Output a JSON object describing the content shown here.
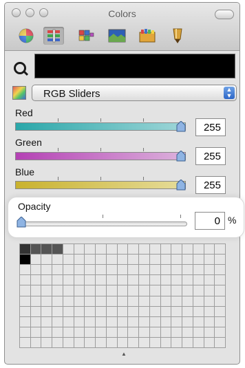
{
  "window": {
    "title": "Colors"
  },
  "toolbar": {
    "items": [
      {
        "name": "color-wheel"
      },
      {
        "name": "color-sliders",
        "selected": true
      },
      {
        "name": "color-palettes"
      },
      {
        "name": "image-palettes"
      },
      {
        "name": "crayons-box"
      },
      {
        "name": "crayon-pencils"
      }
    ]
  },
  "current_color": "#000000",
  "mode": {
    "label": "RGB Sliders"
  },
  "sliders": {
    "red": {
      "label": "Red",
      "value": "255",
      "level": 1.0,
      "colors": [
        "#2aa7a9",
        "#9fd6d8"
      ]
    },
    "green": {
      "label": "Green",
      "value": "255",
      "level": 1.0,
      "colors": [
        "#b441b4",
        "#dcb2dc"
      ]
    },
    "blue": {
      "label": "Blue",
      "value": "255",
      "level": 1.0,
      "colors": [
        "#c9b22e",
        "#e6dc9a"
      ]
    }
  },
  "opacity": {
    "label": "Opacity",
    "value": "0",
    "unit": "%",
    "level": 0.0
  },
  "swatches": {
    "rows": 10,
    "cols": 19
  }
}
